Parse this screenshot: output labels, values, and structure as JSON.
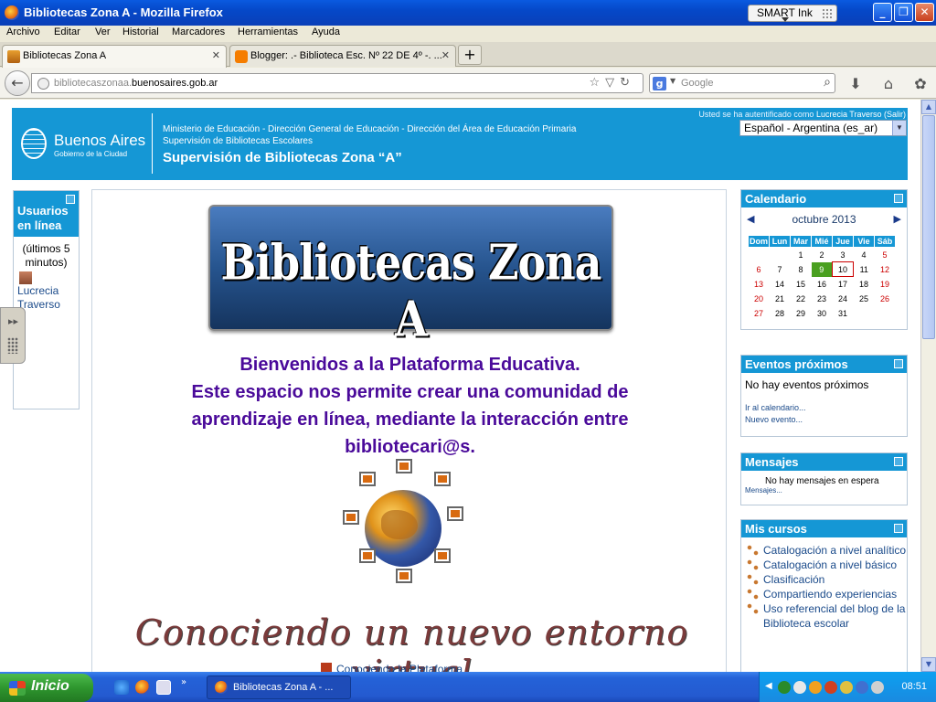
{
  "window": {
    "title": "Bibliotecas Zona A - Mozilla Firefox",
    "smartink": "SMART Ink"
  },
  "menu": [
    "Archivo",
    "Editar",
    "Ver",
    "Historial",
    "Marcadores",
    "Herramientas",
    "Ayuda"
  ],
  "tabs": [
    {
      "label": "Bibliotecas Zona A",
      "active": true
    },
    {
      "label": "Blogger: .- Biblioteca Esc. Nº 22 DE 4º -. ...",
      "active": false
    }
  ],
  "nav": {
    "url_prefix": "bibliotecaszonaa.",
    "url_domain": "buenosaires.gob.ar",
    "search_placeholder": "Google"
  },
  "banner": {
    "city": "Buenos Aires",
    "city_sub": "Gobierno de la Ciudad",
    "line1": "Ministerio de Educación - Dirección General de Educación - Dirección del Área de Educación Primaria",
    "line2": "Supervisión de Bibliotecas Escolares",
    "line3": "Supervisión de Bibliotecas Zona  “A”",
    "auth_text": "Usted se ha autentificado como",
    "auth_user": "Lucrecia Traverso",
    "auth_logout": "(Salir)",
    "language": "Español - Argentina (es_ar)"
  },
  "online_users": {
    "title": "Usuarios en línea",
    "period": "(últimos 5 minutos)",
    "user": "Lucrecia Traverso"
  },
  "main": {
    "logo_text": "Bibliotecas Zona A",
    "welcome_1": "Bienvenidos a la Plataforma Educativa.",
    "welcome_2": "Este espacio nos permite crear una comunidad de aprendizaje en línea, mediante la interacción entre bibliotecari@s.",
    "tagline": "Conociendo un nuevo entorno virtual",
    "link": "Conociendo la Plataforma"
  },
  "calendar": {
    "title": "Calendario",
    "month": "octubre 2013",
    "days": [
      "Dom",
      "Lun",
      "Mar",
      "Mié",
      "Jue",
      "Vie",
      "Sáb"
    ],
    "weeks": [
      [
        "",
        "",
        "1",
        "2",
        "3",
        "4",
        "5"
      ],
      [
        "6",
        "7",
        "8",
        "9",
        "10",
        "11",
        "12"
      ],
      [
        "13",
        "14",
        "15",
        "16",
        "17",
        "18",
        "19"
      ],
      [
        "20",
        "21",
        "22",
        "23",
        "24",
        "25",
        "26"
      ],
      [
        "27",
        "28",
        "29",
        "30",
        "31",
        "",
        ""
      ]
    ],
    "event_day": "9",
    "today": "10"
  },
  "events": {
    "title": "Eventos próximos",
    "none": "No hay eventos próximos",
    "goto": "Ir al calendario...",
    "new": "Nuevo evento..."
  },
  "messages": {
    "title": "Mensajes",
    "none": "No hay mensajes en espera",
    "link": "Mensajes..."
  },
  "courses": {
    "title": "Mis cursos",
    "items": [
      "Catalogación a nivel analítico",
      "Catalogación a nivel básico",
      "Clasificación",
      "Compartiendo experiencias",
      "Uso referencial del blog de la Biblioteca escolar"
    ]
  },
  "taskbar": {
    "start": "Inicio",
    "task": "Bibliotecas Zona A - ...",
    "clock": "08:51"
  },
  "colors": {
    "moodle_blue": "#1597d5",
    "welcome_purple": "#4a0a9a",
    "xp_blue": "#245ad0"
  }
}
